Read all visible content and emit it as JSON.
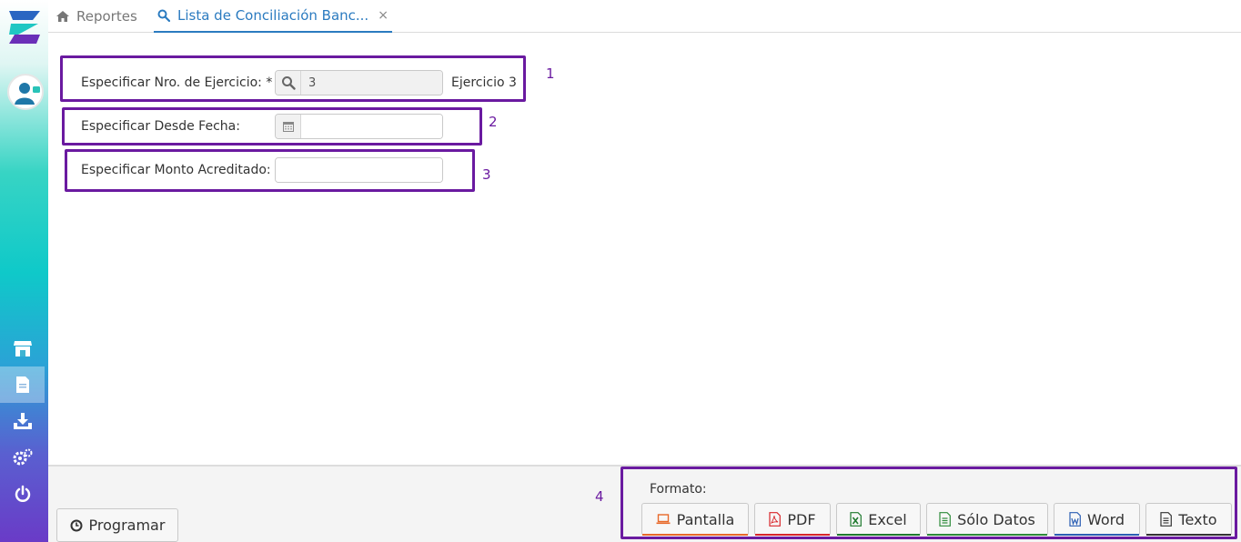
{
  "tabs": [
    {
      "label": "Reportes",
      "icon": "home-icon"
    },
    {
      "label": "Lista de Conciliación Banc...",
      "icon": "search-icon",
      "close": "×"
    }
  ],
  "form": {
    "ejercicio": {
      "label": "Especificar Nro. de Ejercicio: *",
      "value": "3",
      "hint": "Ejercicio 3"
    },
    "desde_fecha": {
      "label": "Especificar Desde Fecha:",
      "value": ""
    },
    "monto": {
      "label": "Especificar Monto Acreditado:",
      "value": ""
    }
  },
  "annotations": [
    "1",
    "2",
    "3",
    "4"
  ],
  "bottom": {
    "programar_label": "Programar",
    "formato_label": "Formato:",
    "formats": [
      {
        "label": "Pantalla",
        "icon": "laptop-icon",
        "color": "#e8692a"
      },
      {
        "label": "PDF",
        "icon": "pdf-icon",
        "color": "#d9262a"
      },
      {
        "label": "Excel",
        "icon": "excel-icon",
        "color": "#1f7a2e"
      },
      {
        "label": "Sólo Datos",
        "icon": "sheet-icon",
        "color": "#2e8b3a"
      },
      {
        "label": "Word",
        "icon": "word-icon",
        "color": "#2b5fb4"
      },
      {
        "label": "Texto",
        "icon": "text-file-icon",
        "color": "#333333"
      }
    ]
  },
  "colors": {
    "accent": "#2b7bc0",
    "annotation": "#6a1aa0"
  }
}
